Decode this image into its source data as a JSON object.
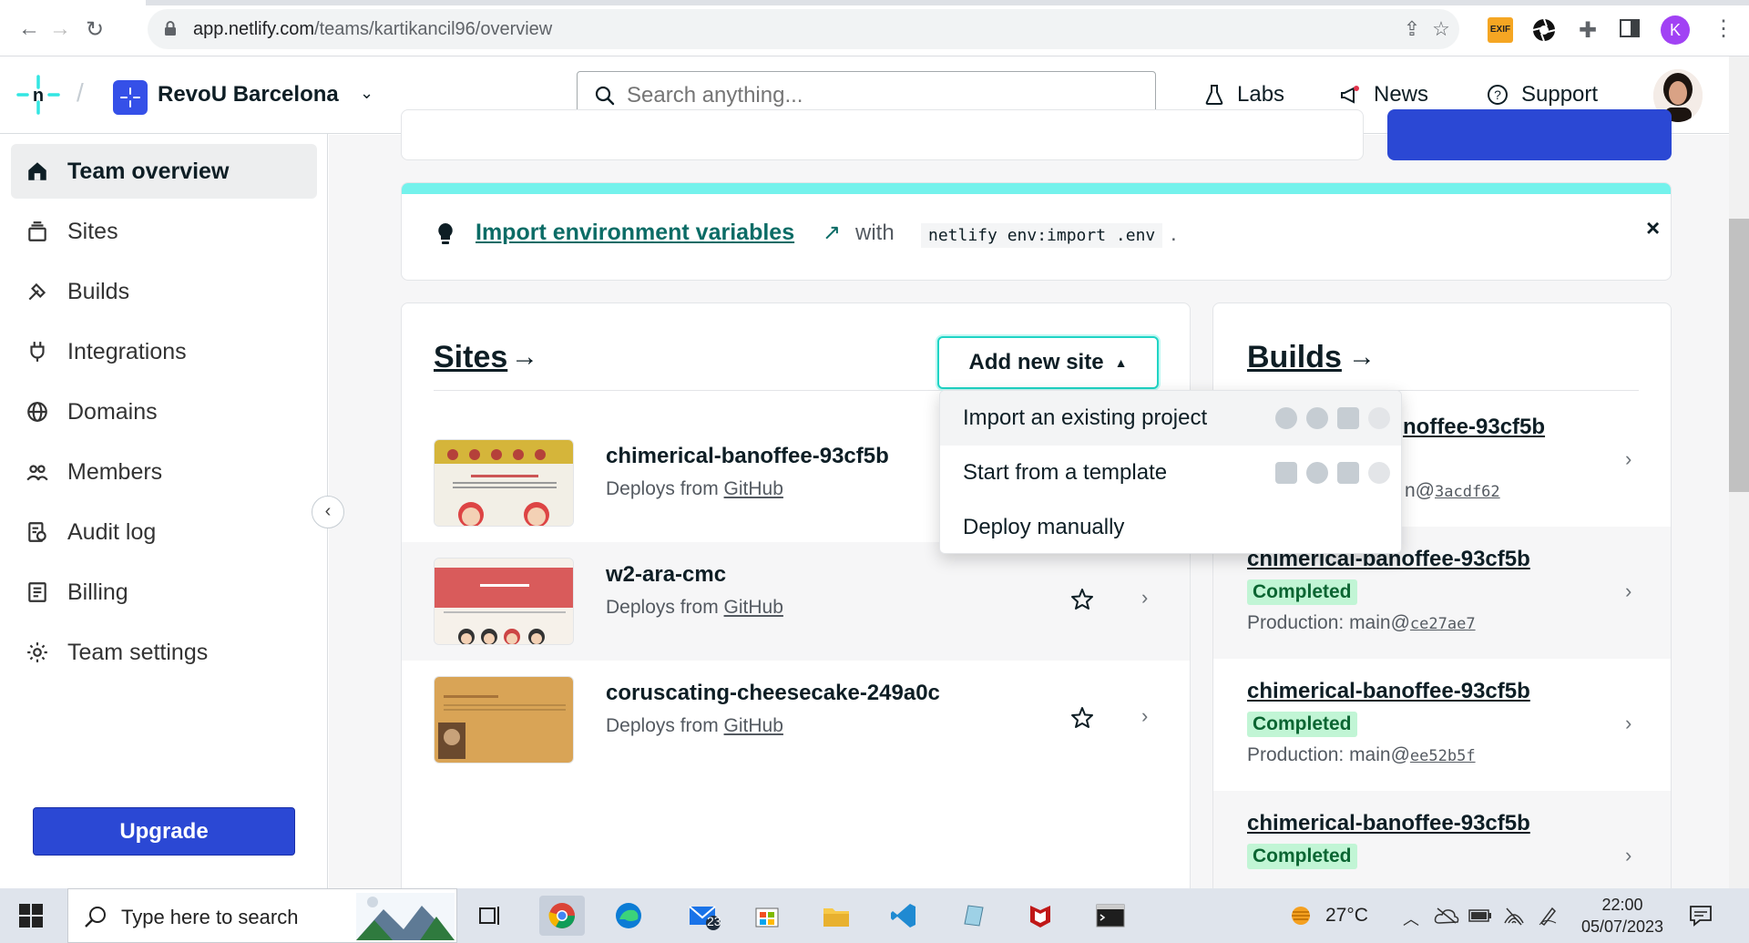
{
  "browser": {
    "url_host": "app.netlify.com",
    "url_path": "/teams/kartikancil96/overview",
    "profile_initial": "K"
  },
  "header": {
    "team_name": "RevoU Barcelona",
    "search_placeholder": "Search anything...",
    "labs": "Labs",
    "news": "News",
    "support": "Support"
  },
  "sidebar": {
    "items": [
      {
        "label": "Team overview",
        "icon": "home-icon",
        "active": true
      },
      {
        "label": "Sites",
        "icon": "sites-icon"
      },
      {
        "label": "Builds",
        "icon": "builds-icon"
      },
      {
        "label": "Integrations",
        "icon": "integrations-icon"
      },
      {
        "label": "Domains",
        "icon": "globe-icon"
      },
      {
        "label": "Members",
        "icon": "members-icon"
      },
      {
        "label": "Audit log",
        "icon": "audit-log-icon"
      },
      {
        "label": "Billing",
        "icon": "billing-icon"
      },
      {
        "label": "Team settings",
        "icon": "gear-icon"
      }
    ],
    "upgrade": "Upgrade"
  },
  "env_banner": {
    "link": "Import environment variables",
    "arrow": "↗",
    "with": "with",
    "code": "netlify env:import .env",
    "dot": ".",
    "close": "×"
  },
  "sites": {
    "title": "Sites",
    "arrow": "→",
    "add_button": "Add new site",
    "deploys_prefix": "Deploys from",
    "list": [
      {
        "name": "chimerical-banoffee-93cf5b",
        "source": "GitHub"
      },
      {
        "name": "w2-ara-cmc",
        "source": "GitHub"
      },
      {
        "name": "coruscating-cheesecake-249a0c",
        "source": "GitHub"
      }
    ]
  },
  "dropdown": {
    "items": [
      {
        "label": "Import an existing project"
      },
      {
        "label": "Start from a template"
      },
      {
        "label": "Deploy manually"
      }
    ]
  },
  "builds": {
    "title": "Builds",
    "arrow": "→",
    "list": [
      {
        "name_visible": "noffee-93cf5b",
        "prod_visible": "n@",
        "sha": "3acdf62"
      },
      {
        "name": "chimerical-banoffee-93cf5b",
        "status": "Completed",
        "prod_prefix": "Production: main@",
        "sha": "ce27ae7"
      },
      {
        "name": "chimerical-banoffee-93cf5b",
        "status": "Completed",
        "prod_prefix": "Production: main@",
        "sha": "ee52b5f"
      },
      {
        "name": "chimerical-banoffee-93cf5b",
        "status": "Completed"
      }
    ]
  },
  "taskbar": {
    "search_text": "Type here to search",
    "mail_badge": "23",
    "temperature": "27°C",
    "time": "22:00",
    "date": "05/07/2023"
  },
  "colors": {
    "netlify_teal": "#32e6e2",
    "primary_blue": "#2b48d4",
    "completed_bg": "#c1f5d5"
  }
}
